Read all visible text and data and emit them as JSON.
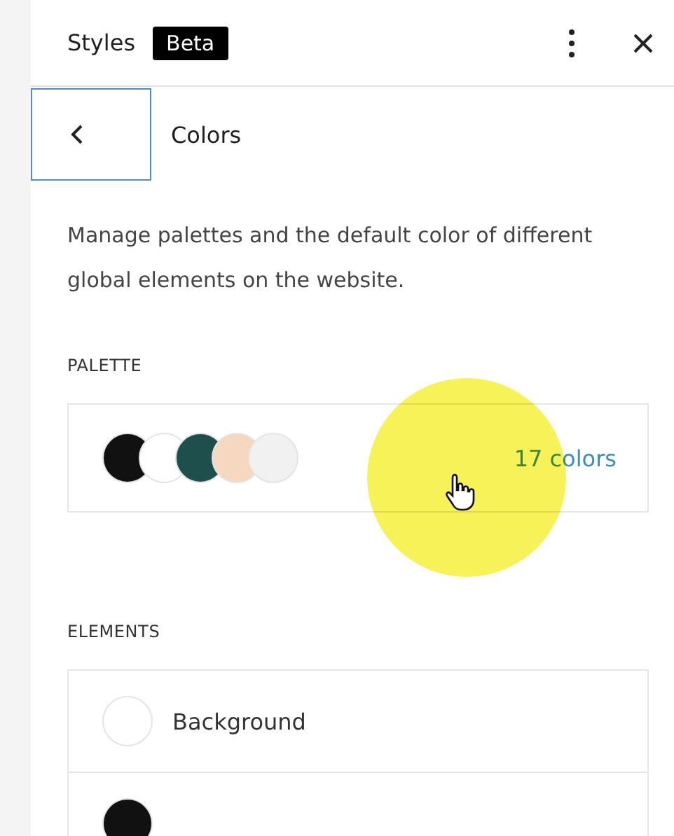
{
  "header": {
    "title": "Styles",
    "badge": "Beta"
  },
  "nav": {
    "title": "Colors"
  },
  "description": "Manage palettes and the default color of different global elements on the website.",
  "palette": {
    "heading": "PALETTE",
    "swatches": [
      {
        "color": "#111111"
      },
      {
        "color": "#ffffff"
      },
      {
        "color": "#1f4f4c"
      },
      {
        "color": "#f6d7bf"
      },
      {
        "color": "#f1f1f1"
      }
    ],
    "count": "17 colors"
  },
  "elements": {
    "heading": "ELEMENTS",
    "items": [
      {
        "label": "Background",
        "color": "#ffffff"
      },
      {
        "color": "#111111"
      }
    ]
  }
}
